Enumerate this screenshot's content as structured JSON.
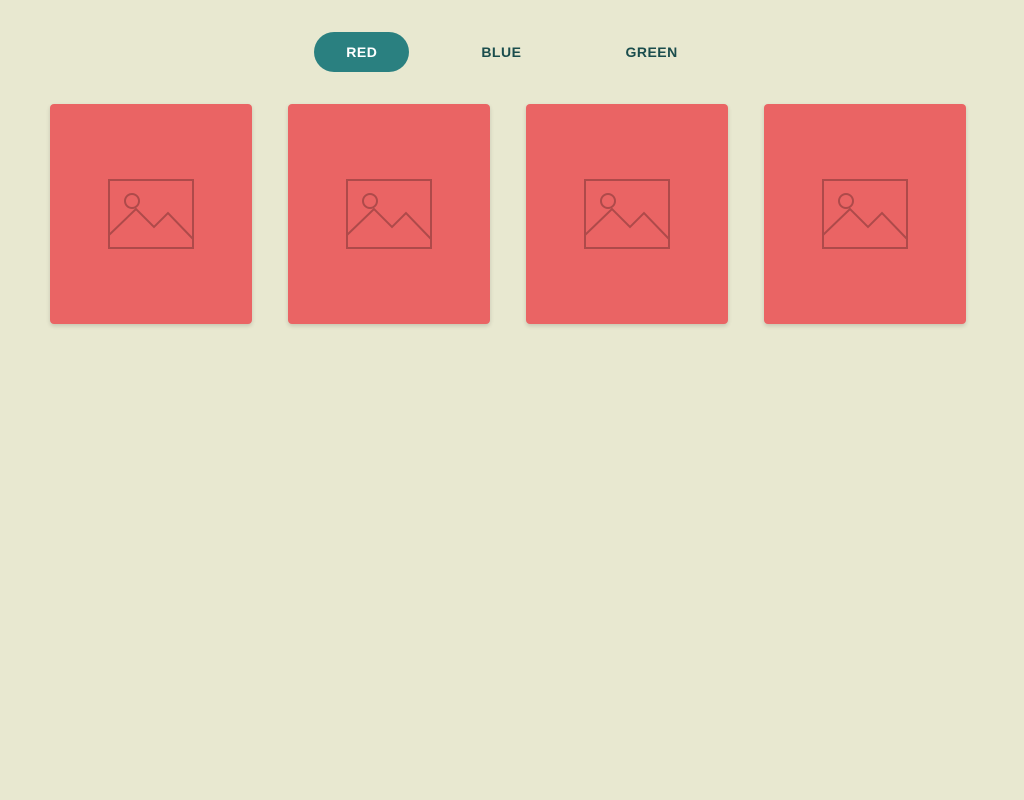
{
  "tabs": [
    {
      "label": "RED",
      "active": true
    },
    {
      "label": "BLUE",
      "active": false
    },
    {
      "label": "GREEN",
      "active": false
    }
  ],
  "cards": {
    "count": 4,
    "color": "#ea6464"
  },
  "colors": {
    "background": "#e8e8d0",
    "tabActive": "#2a8080",
    "tabText": "#1a4d4d",
    "cardRed": "#ea6464"
  }
}
